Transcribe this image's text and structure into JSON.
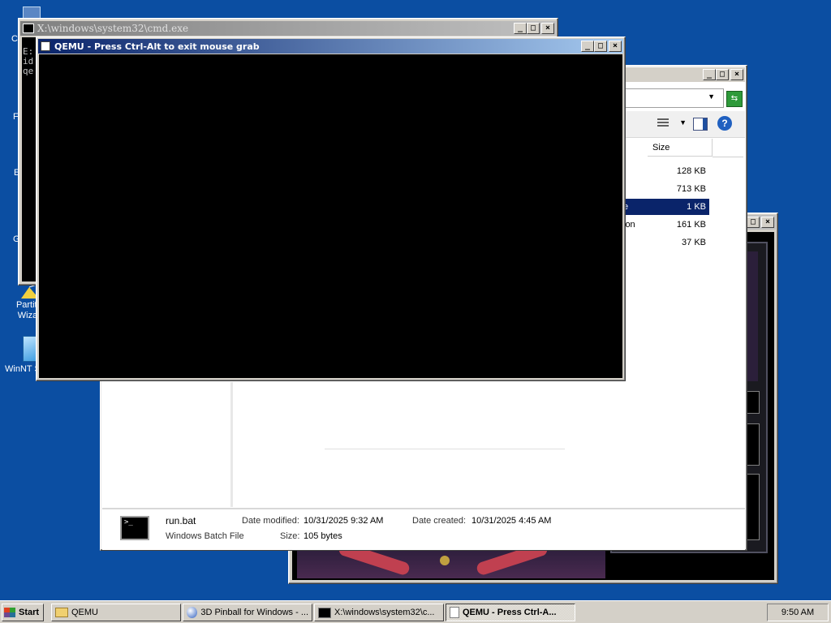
{
  "desktop": {
    "icons": [
      {
        "label": "Partiti\nWiza"
      },
      {
        "label": "WinNT S"
      }
    ],
    "partial_letters": [
      "C",
      "F",
      "E",
      "G"
    ]
  },
  "cmd_window": {
    "title": "X:\\windows\\system32\\cmd.exe",
    "lines": [
      "E:",
      "id",
      "qe"
    ]
  },
  "qemu_window": {
    "title": "QEMU - Press Ctrl-Alt to exit mouse grab"
  },
  "explorer": {
    "columns": {
      "size": "Size"
    },
    "rows": [
      {
        "name_fragment": "",
        "size": "128 KB",
        "selected": false
      },
      {
        "name_fragment": "",
        "size": "713 KB",
        "selected": false
      },
      {
        "name_fragment": "e",
        "size": "1 KB",
        "selected": true
      },
      {
        "name_fragment": "ion",
        "size": "161 KB",
        "selected": false
      },
      {
        "name_fragment": "",
        "size": "37 KB",
        "selected": false
      }
    ],
    "details": {
      "file_name": "run.bat",
      "file_type": "Windows Batch File",
      "date_modified_label": "Date modified:",
      "date_modified": "10/31/2025 9:32 AM",
      "date_created_label": "Date created:",
      "date_created": "10/31/2025 4:45 AM",
      "size_label": "Size:",
      "size": "105 bytes"
    }
  },
  "taskbar": {
    "start_label": "Start",
    "buttons": [
      {
        "label": "QEMU",
        "icon": "folder-icon",
        "pressed": false
      },
      {
        "label": "3D Pinball for Windows - ...",
        "icon": "pinball-icon",
        "pressed": false
      },
      {
        "label": "X:\\windows\\system32\\c...",
        "icon": "console-icon",
        "pressed": false
      },
      {
        "label": "QEMU - Press Ctrl-A...",
        "icon": "window-icon",
        "pressed": true
      }
    ],
    "clock": "9:50 AM"
  },
  "colors": {
    "desktop": "#0b4ea2",
    "selection": "#0a246a",
    "active_title": "#0a246a"
  }
}
